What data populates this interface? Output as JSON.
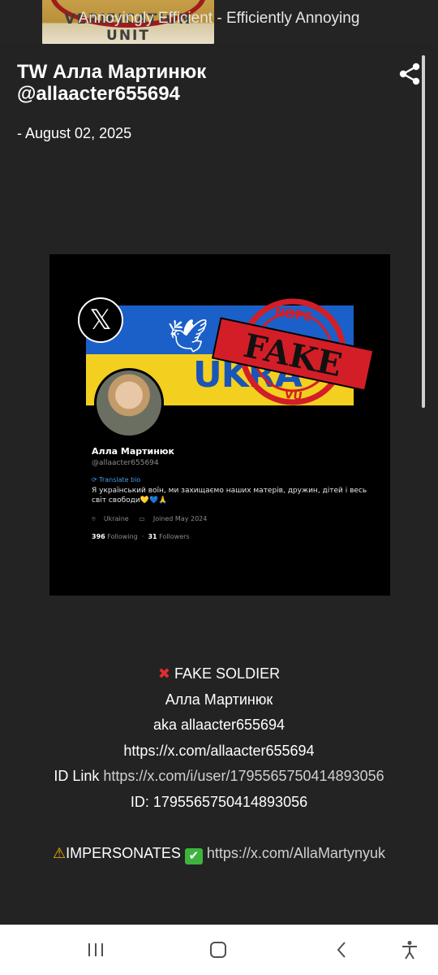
{
  "header": {
    "badge_text": "VERIFICATION UNIT",
    "tagline": "Annoyingly Efficient - Efficiently Annoying"
  },
  "post": {
    "title": "TW Алла Мартинюк @allaacter655694",
    "date": "- August 02, 2025",
    "share_icon": "share-icon"
  },
  "embedded_image": {
    "flag_text": "UKRA",
    "stamp": {
      "top": "NOPE",
      "main": "FAKE",
      "bottom": "VU"
    },
    "profile": {
      "name": "Алла Мартинюк",
      "handle": "@allaacter655694",
      "translate_label": "Translate bio",
      "bio": "Я український воїн, ми захищаємо наших матерів, дружин, дітей і весь світ свободи💛💙🙏",
      "location": "Ukraine",
      "joined": "Joined May 2024",
      "following_count": "396",
      "following_label": "Following",
      "followers_count": "31",
      "followers_label": "Followers"
    }
  },
  "body": {
    "fake_label": "FAKE SOLDIER",
    "name_line": "Алла Мартинюк",
    "aka_line": "aka allaacter655694",
    "profile_url": "https://x.com/allaacter655694",
    "id_link_label": "ID Link",
    "id_link_url": "https://x.com/i/user/1795565750414893056",
    "id_line": "ID: 1795565750414893056",
    "impersonates_label": "IMPERSONATES",
    "impersonates_url": "https://x.com/AllaMartynyuk"
  },
  "colors": {
    "page_bg": "#1b1b1b",
    "post_bg": "#232323",
    "link": "#d0d0d0",
    "x_mark": "#e22e2e",
    "stamp_red": "#d31e27"
  }
}
